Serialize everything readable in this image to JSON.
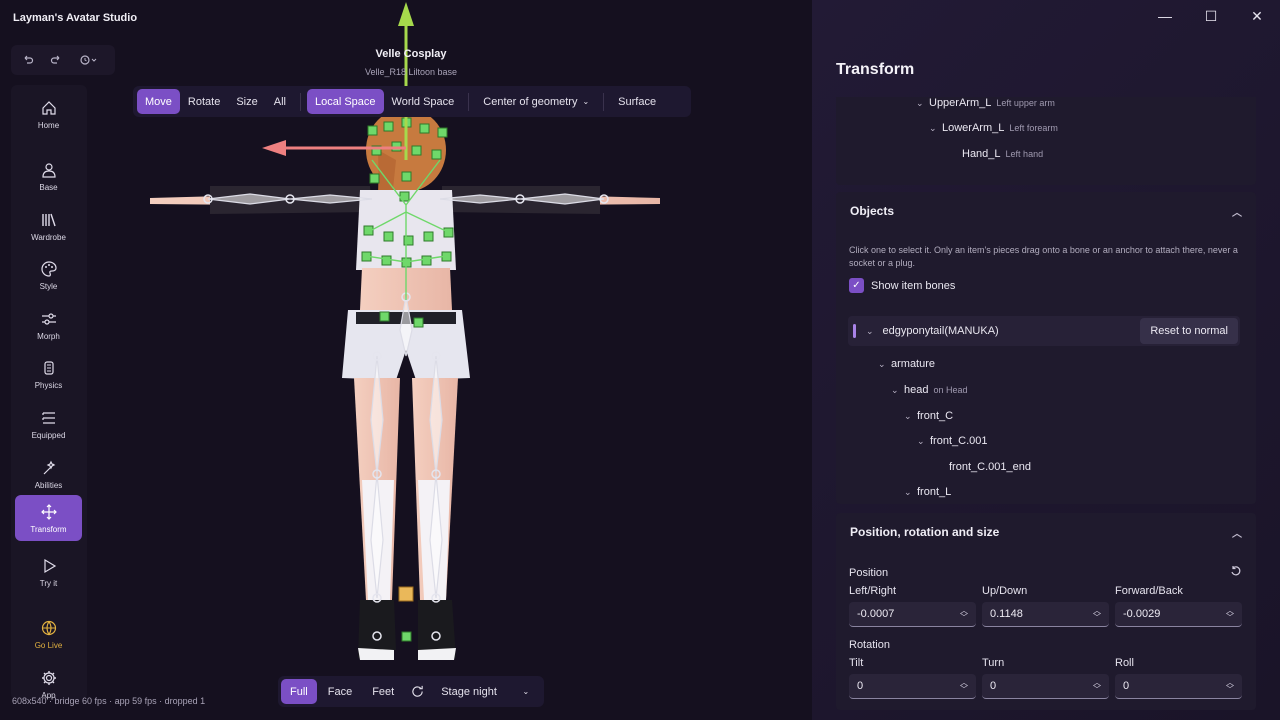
{
  "app": {
    "title": "Layman's Avatar Studio"
  },
  "window": {
    "minimize": "—",
    "maximize": "☐",
    "close": "✕"
  },
  "history": {
    "undo_icon": "undo-icon",
    "redo_icon": "redo-icon",
    "history_icon": "history-icon"
  },
  "sidebar": {
    "items": [
      {
        "label": "Home",
        "icon": "home-icon"
      },
      {
        "label": "Base",
        "icon": "person-icon"
      },
      {
        "label": "Wardrobe",
        "icon": "wardrobe-icon"
      },
      {
        "label": "Style",
        "icon": "palette-icon"
      },
      {
        "label": "Morph",
        "icon": "sliders-icon"
      },
      {
        "label": "Physics",
        "icon": "physics-icon"
      },
      {
        "label": "Equipped",
        "icon": "list-icon"
      },
      {
        "label": "Abilities",
        "icon": "wand-icon"
      },
      {
        "label": "Transform",
        "icon": "move-icon",
        "active": true
      },
      {
        "label": "Try it",
        "icon": "play-icon"
      },
      {
        "label": "Go Live",
        "icon": "globe-icon",
        "accent": "#e2b140"
      },
      {
        "label": "App",
        "icon": "gear-icon"
      }
    ]
  },
  "toolbar": {
    "move": "Move",
    "rotate": "Rotate",
    "size": "Size",
    "all": "All",
    "local_space": "Local Space",
    "world_space": "World Space",
    "pivot": "Center of geometry",
    "surface": "Surface"
  },
  "avatar": {
    "name": "Velle Cosplay",
    "base": "Velle_R18 Liltoon base"
  },
  "stats": "608x540 · bridge 60 fps · app 59 fps · dropped 1",
  "bottom_bar": {
    "full": "Full",
    "face": "Face",
    "feet": "Feet",
    "lighting": "Stage night"
  },
  "panel": {
    "title": "Transform",
    "bones_top": [
      {
        "name": "UpperArm_L",
        "hint": "Left upper arm"
      },
      {
        "name": "LowerArm_L",
        "hint": "Left forearm"
      },
      {
        "name": "Hand_L",
        "hint": "Left hand"
      }
    ],
    "objects": {
      "title": "Objects",
      "help": "Click one to select it. Only an item's pieces drag onto a bone or an anchor to attach there, never a socket or a plug.",
      "show_bones": "Show item bones",
      "item": "edgyponytail(MANUKA)",
      "reset": "Reset to normal",
      "tree": [
        {
          "name": "armature",
          "hint": ""
        },
        {
          "name": "head",
          "hint": "on Head"
        },
        {
          "name": "front_C",
          "hint": ""
        },
        {
          "name": "front_C.001",
          "hint": ""
        },
        {
          "name": "front_C.001_end",
          "hint": ""
        },
        {
          "name": "front_L",
          "hint": ""
        }
      ]
    },
    "prs": {
      "title": "Position, rotation and size",
      "position_label": "Position",
      "left_right": "Left/Right",
      "up_down": "Up/Down",
      "forward_back": "Forward/Back",
      "pos_x": "-0.0007",
      "pos_y": "0.1148",
      "pos_z": "-0.0029",
      "rotation_label": "Rotation",
      "tilt": "Tilt",
      "turn": "Turn",
      "roll": "Roll",
      "rot_x": "0",
      "rot_y": "0",
      "rot_z": "0"
    }
  },
  "colors": {
    "accent": "#7b4fc5",
    "gizmo_up": "#a6d94c",
    "gizmo_left": "#ee8080",
    "bone_handle": "#6fd86a",
    "live": "#e2b140"
  }
}
